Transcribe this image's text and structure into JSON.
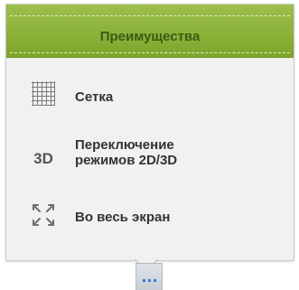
{
  "panel": {
    "title": "Преимущества",
    "items": [
      {
        "label": "Сетка",
        "icon": "grid-icon"
      },
      {
        "label_line1": "Переключение",
        "label_line2": "режимов 2D/3D",
        "icon": "3d-icon",
        "icon_text": "3D"
      },
      {
        "label": "Во весь экран",
        "icon": "fullscreen-icon"
      }
    ]
  },
  "more_button": {
    "icon": "more-dots-icon"
  },
  "colors": {
    "header_green": "#8bb13a",
    "header_text": "#3d5a14",
    "panel_bg": "#f1f1f1",
    "dot_blue": "#2d7fd6"
  }
}
